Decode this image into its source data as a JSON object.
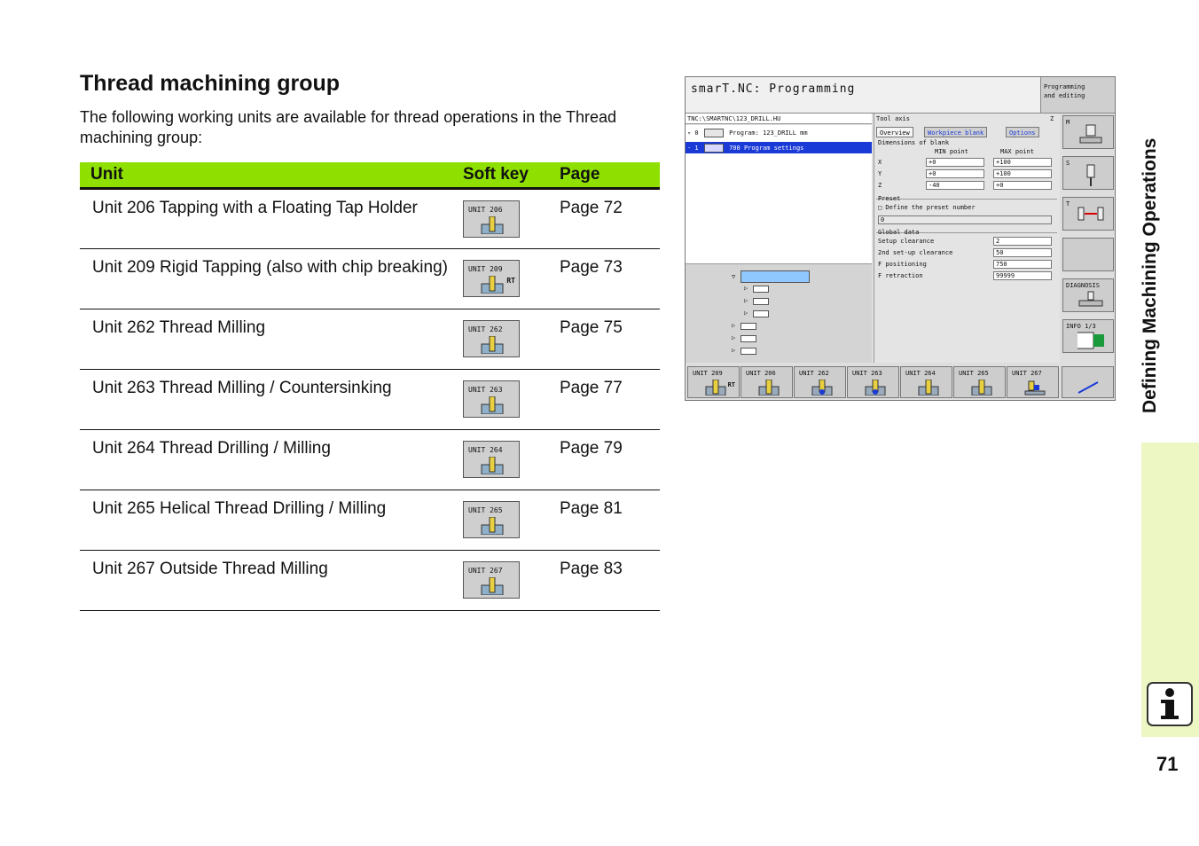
{
  "heading": "Thread machining group",
  "intro": "The following working units are available for thread operations in the Thread machining group:",
  "table": {
    "headers": [
      "Unit",
      "Soft key",
      "Page"
    ],
    "rows": [
      {
        "unit": "Unit 206 Tapping with a Floating Tap Holder",
        "key_label": "UNIT 206",
        "key_rt": "",
        "page": "Page 72"
      },
      {
        "unit": "Unit 209 Rigid Tapping (also with chip breaking)",
        "key_label": "UNIT 209",
        "key_rt": "RT",
        "page": "Page 73"
      },
      {
        "unit": "Unit 262 Thread Milling",
        "key_label": "UNIT 262",
        "key_rt": "",
        "page": "Page 75"
      },
      {
        "unit": "Unit 263 Thread Milling / Countersinking",
        "key_label": "UNIT 263",
        "key_rt": "",
        "page": "Page 77"
      },
      {
        "unit": "Unit 264 Thread Drilling / Milling",
        "key_label": "UNIT 264",
        "key_rt": "",
        "page": "Page 79"
      },
      {
        "unit": "Unit 265 Helical Thread Drilling / Milling",
        "key_label": "UNIT 265",
        "key_rt": "",
        "page": "Page 81"
      },
      {
        "unit": "Unit 267 Outside Thread Milling",
        "key_label": "UNIT 267",
        "key_rt": "",
        "page": "Page 83"
      }
    ]
  },
  "screen": {
    "title": "smarT.NC: Programming",
    "mode_line1": "Programming",
    "mode_line2": "and editing",
    "path": "TNC:\\SMARTNC\\123_DRILL.HU",
    "tree_row0": "▿ 0",
    "tree_row0_text": "Program: 123_DRILL mm",
    "tree_row1": "· 1",
    "tree_row1_text": "700 Program settings",
    "tool_axis": "Tool axis",
    "tool_axis_value": "Z",
    "tabs": [
      "Overview",
      "Workpiece blank",
      "Options"
    ],
    "dimensions_label": "Dimensions of blank",
    "min_point": "MIN point",
    "max_point": "MAX point",
    "axes": [
      {
        "axis": "X",
        "min": "+0",
        "max": "+100"
      },
      {
        "axis": "Y",
        "min": "+0",
        "max": "+100"
      },
      {
        "axis": "Z",
        "min": "-40",
        "max": "+0"
      }
    ],
    "preset_label": "Preset",
    "preset_check": "□ Define the preset number",
    "preset_value": "0",
    "global_label": "Global data",
    "global": [
      {
        "label": "Setup clearance",
        "value": "2"
      },
      {
        "label": "2nd set-up clearance",
        "value": "50"
      },
      {
        "label": "F positioning",
        "value": "750"
      },
      {
        "label": "F retraction",
        "value": "99999"
      }
    ],
    "vkeys": [
      "M",
      "S",
      "T",
      "",
      "DIAGNOSIS",
      "INFO 1/3"
    ],
    "hkeys": [
      {
        "label": "UNIT 209",
        "rt": "RT"
      },
      {
        "label": "UNIT 206",
        "rt": ""
      },
      {
        "label": "UNIT 262",
        "rt": ""
      },
      {
        "label": "UNIT 263",
        "rt": ""
      },
      {
        "label": "UNIT 264",
        "rt": ""
      },
      {
        "label": "UNIT 265",
        "rt": ""
      },
      {
        "label": "UNIT 267",
        "rt": ""
      }
    ]
  },
  "side_title": "Defining Machining Operations",
  "page_number": "71",
  "colors": {
    "header_green": "#8fe000",
    "side_panel": "#ecf7c4",
    "select_blue": "#1a3ad8"
  }
}
